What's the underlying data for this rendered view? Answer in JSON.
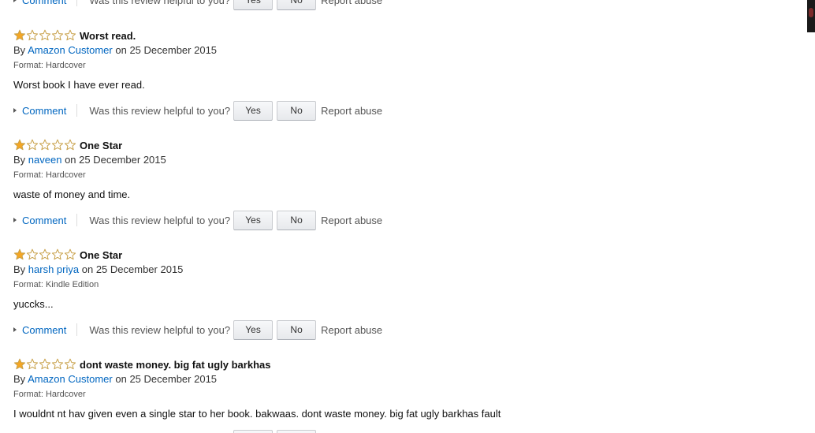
{
  "helpful_prompt": "Was this review helpful to you?",
  "comment_label": "Comment",
  "yes_label": "Yes",
  "no_label": "No",
  "report_label": "Report abuse",
  "by_prefix": "By",
  "on_word": "on",
  "reviews": [
    {
      "rating": 1,
      "max_rating": 5,
      "title": "Worst read.",
      "author": "Amazon Customer",
      "date": "25 December 2015",
      "format": "Format: Hardcover",
      "body": "Worst book I have ever read."
    },
    {
      "rating": 1,
      "max_rating": 5,
      "title": "One Star",
      "author": "naveen",
      "date": "25 December 2015",
      "format": "Format: Hardcover",
      "body": "waste of money and time."
    },
    {
      "rating": 1,
      "max_rating": 5,
      "title": "One Star",
      "author": "harsh priya",
      "date": "25 December 2015",
      "format": "Format: Kindle Edition",
      "body": "yuccks..."
    },
    {
      "rating": 1,
      "max_rating": 5,
      "title": "dont waste money. big fat ugly barkhas",
      "author": "Amazon Customer",
      "date": "25 December 2015",
      "format": "Format: Hardcover",
      "body": "I wouldnt nt hav given even a single star to her book. bakwaas. dont waste money. big fat ugly barkhas fault"
    }
  ],
  "colors": {
    "link": "#0066c0",
    "star_fill": "#f5a623",
    "star_outline": "#c8a14a",
    "text": "#111111",
    "muted": "#555555"
  }
}
